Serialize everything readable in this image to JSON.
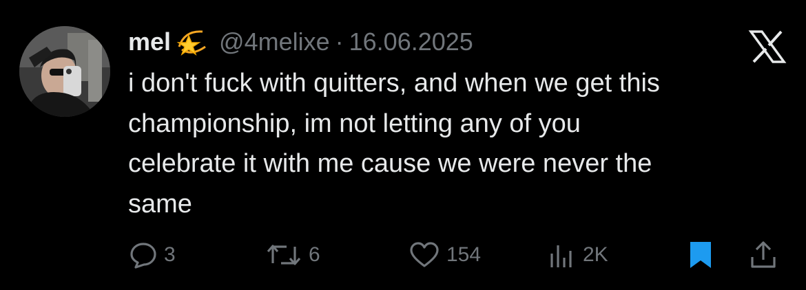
{
  "tweet": {
    "display_name": "mel",
    "emoji_icon": "dizzy-star-emoji",
    "handle": "@4melixe",
    "separator": "·",
    "date": "16.06.2025",
    "text_lines": [
      "i don't fuck with quitters, and when we get this",
      "championship, im not letting any of you",
      "celebrate it with me cause we were never the",
      "same"
    ]
  },
  "actions": {
    "replies": "3",
    "reposts": "6",
    "likes": "154",
    "views": "2K"
  },
  "colors": {
    "background": "#000000",
    "text_primary": "#e7e9ea",
    "text_secondary": "#71767b",
    "bookmark_active": "#1d9bf0"
  }
}
